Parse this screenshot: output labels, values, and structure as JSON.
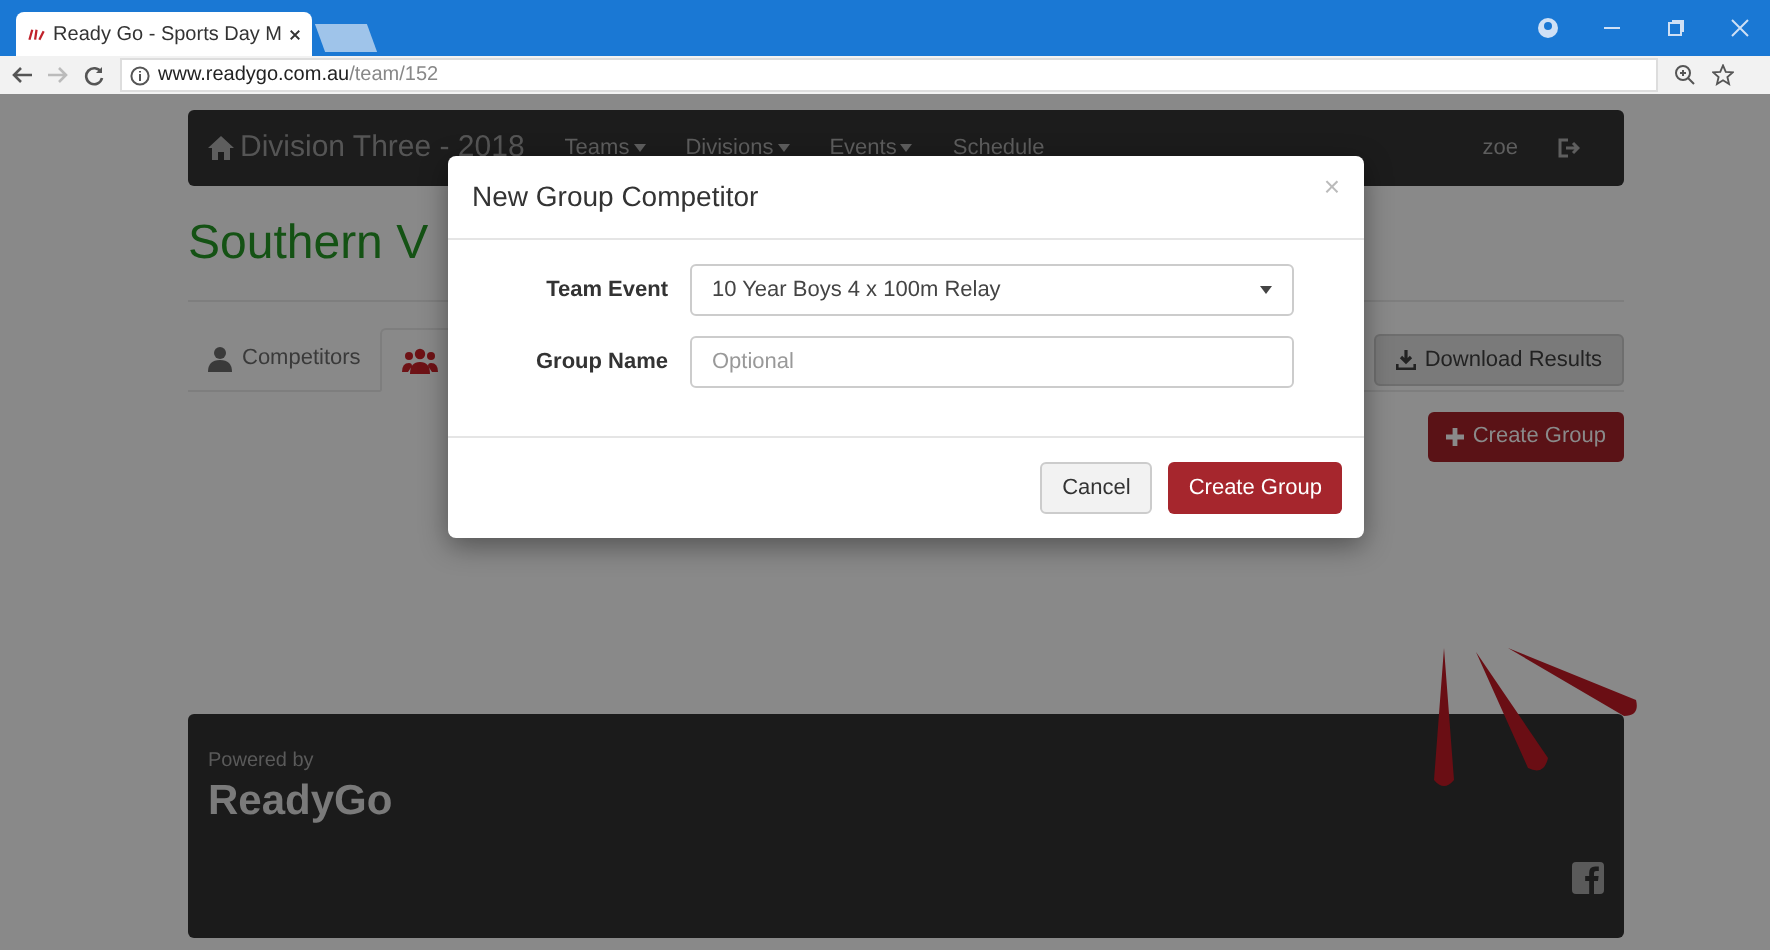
{
  "browser": {
    "tab_title": "Ready Go - Sports Day M",
    "url_host": "www.readygo.com.au",
    "url_path": "/team/152"
  },
  "navbar": {
    "brand": "Division Three - 2018",
    "menus": [
      {
        "label": "Teams",
        "dropdown": true
      },
      {
        "label": "Divisions",
        "dropdown": true
      },
      {
        "label": "Events",
        "dropdown": true
      },
      {
        "label": "Schedule",
        "dropdown": false
      }
    ],
    "user": "zoe"
  },
  "page_title": "Southern V",
  "tabs": [
    {
      "kind": "user",
      "label": "Competitors",
      "selected": false
    },
    {
      "kind": "group",
      "selected": true
    }
  ],
  "download_button": "Download Results",
  "create_button": "Create Group",
  "footer": {
    "powered_by": "Powered by",
    "logo": "ReadyGo"
  },
  "modal": {
    "title": "New Group Competitor",
    "close": "×",
    "fields": [
      {
        "kind": "select",
        "label": "Team Event",
        "value": "10 Year Boys 4 x 100m Relay"
      },
      {
        "kind": "text",
        "label": "Group Name",
        "placeholder": "Optional"
      }
    ],
    "cancel": "Cancel",
    "submit": "Create Group"
  }
}
